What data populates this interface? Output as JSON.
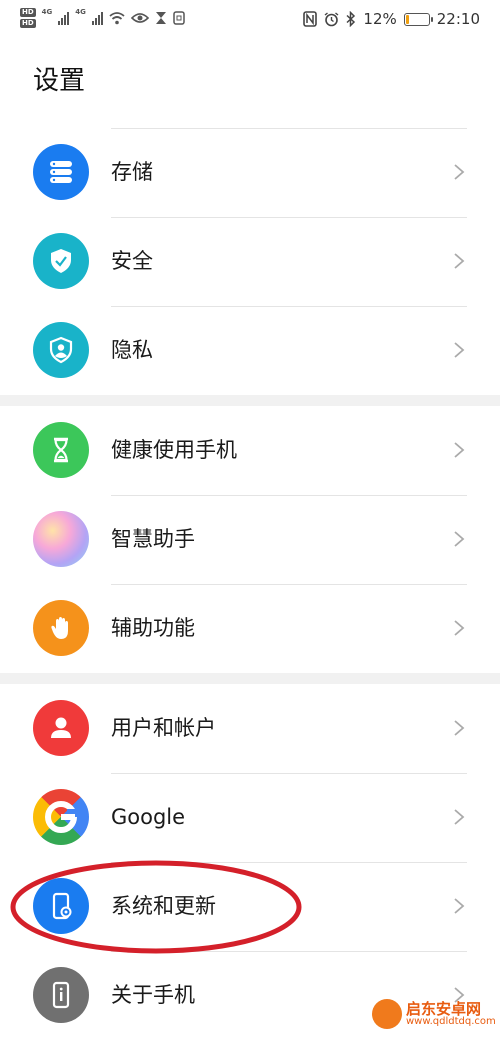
{
  "status_bar": {
    "hd1": "HD",
    "hd2": "HD",
    "net1": "4G",
    "net2": "4G",
    "battery_percent": "12%",
    "battery_level": 0.12,
    "time": "22:10"
  },
  "page": {
    "title": "设置"
  },
  "settings_items": [
    {
      "label": "存储",
      "icon": "storage-icon",
      "color": "#1a7cf0"
    },
    {
      "label": "安全",
      "icon": "shield-check-icon",
      "color": "#19b3c9"
    },
    {
      "label": "隐私",
      "icon": "privacy-icon",
      "color": "#19b3c9"
    },
    {
      "label": "健康使用手机",
      "icon": "hourglass-icon",
      "color": "#3cc75a"
    },
    {
      "label": "智慧助手",
      "icon": "assistant-icon",
      "color": "#e8a0d0"
    },
    {
      "label": "辅助功能",
      "icon": "hand-icon",
      "color": "#f5921b"
    },
    {
      "label": "用户和帐户",
      "icon": "user-icon",
      "color": "#f03a3a"
    },
    {
      "label": "Google",
      "icon": "google-icon",
      "color": "#4285f4"
    },
    {
      "label": "系统和更新",
      "icon": "system-update-icon",
      "color": "#1a7cf0"
    },
    {
      "label": "关于手机",
      "icon": "phone-info-icon",
      "color": "#707070"
    }
  ],
  "watermark": {
    "name": "启东安卓网",
    "url": "www.qdldtdq.com"
  }
}
